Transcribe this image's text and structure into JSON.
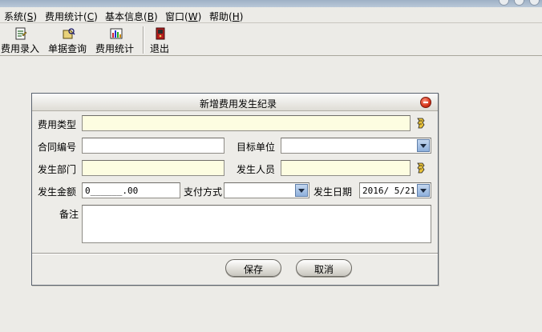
{
  "menubar": {
    "items": [
      {
        "label": "系统",
        "key": "S"
      },
      {
        "label": "费用统计",
        "key": "C"
      },
      {
        "label": "基本信息",
        "key": "B"
      },
      {
        "label": "窗口",
        "key": "W"
      },
      {
        "label": "帮助",
        "key": "H"
      }
    ]
  },
  "toolbar": {
    "buttons": [
      {
        "label": "费用录入",
        "icon": "expense-entry-icon"
      },
      {
        "label": "单据查询",
        "icon": "document-query-icon"
      },
      {
        "label": "费用统计",
        "icon": "expense-statistics-icon"
      },
      {
        "label": "退出",
        "icon": "exit-icon"
      }
    ]
  },
  "dialog": {
    "title": "新增费用发生纪录",
    "fields": {
      "expense_type": {
        "label": "费用类型",
        "value": ""
      },
      "contract_no": {
        "label": "合同编号",
        "value": ""
      },
      "target_unit": {
        "label": "目标单位",
        "value": ""
      },
      "department": {
        "label": "发生部门",
        "value": ""
      },
      "person": {
        "label": "发生人员",
        "value": ""
      },
      "amount": {
        "label": "发生金额",
        "value": "0______.00"
      },
      "payment_method": {
        "label": "支付方式",
        "value": ""
      },
      "date": {
        "label": "发生日期",
        "value": "2016/ 5/21"
      },
      "remark": {
        "label": "备注",
        "value": ""
      }
    },
    "buttons": {
      "save": "保存",
      "cancel": "取消"
    }
  },
  "colors": {
    "input_yellow": "#fdfde1",
    "accent_blue": "#8eb0dc",
    "close_red": "#d43318"
  }
}
